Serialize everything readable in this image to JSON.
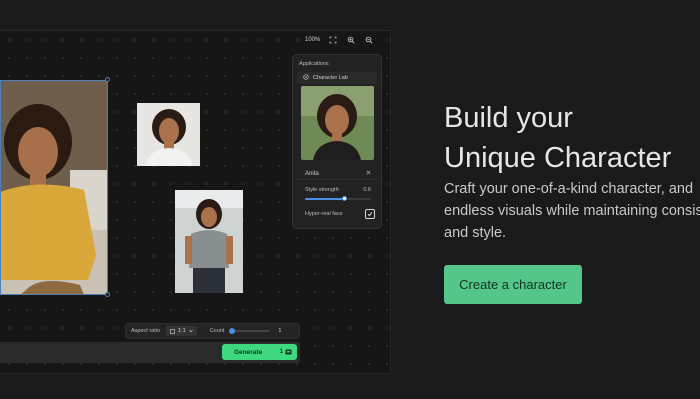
{
  "zoom_bar": {
    "zoom_label": "100%",
    "icons": [
      "fit-frame-icon",
      "zoom-in-icon",
      "zoom-out-icon"
    ]
  },
  "panel": {
    "title": "Applications",
    "app_name": "Character Lab",
    "character_name": "Anita",
    "style_strength_label": "Style strength",
    "style_strength_value": "0.6",
    "style_strength_fraction": 0.6,
    "hyper_real_label": "Hyper-real face",
    "hyper_real_checked": true
  },
  "options_bar": {
    "aspect_ratio_label": "Aspect ratio",
    "aspect_ratio_value": "1:1",
    "count_label": "Count",
    "count_value": "1"
  },
  "generate": {
    "label": "Generate",
    "cost": "1"
  },
  "hero": {
    "title_lines": [
      "Build your",
      "Unique Character"
    ],
    "desc_lines": [
      "Craft your one-of-a-kind character, and",
      "endless visuals while maintaining consistency",
      "and style."
    ],
    "cta_label": "Create a character"
  },
  "colors": {
    "accent_green": "#3ed87f",
    "cta_green": "#55c68a",
    "selection_blue": "#4f7fb8",
    "background": "#1a1a1a"
  }
}
